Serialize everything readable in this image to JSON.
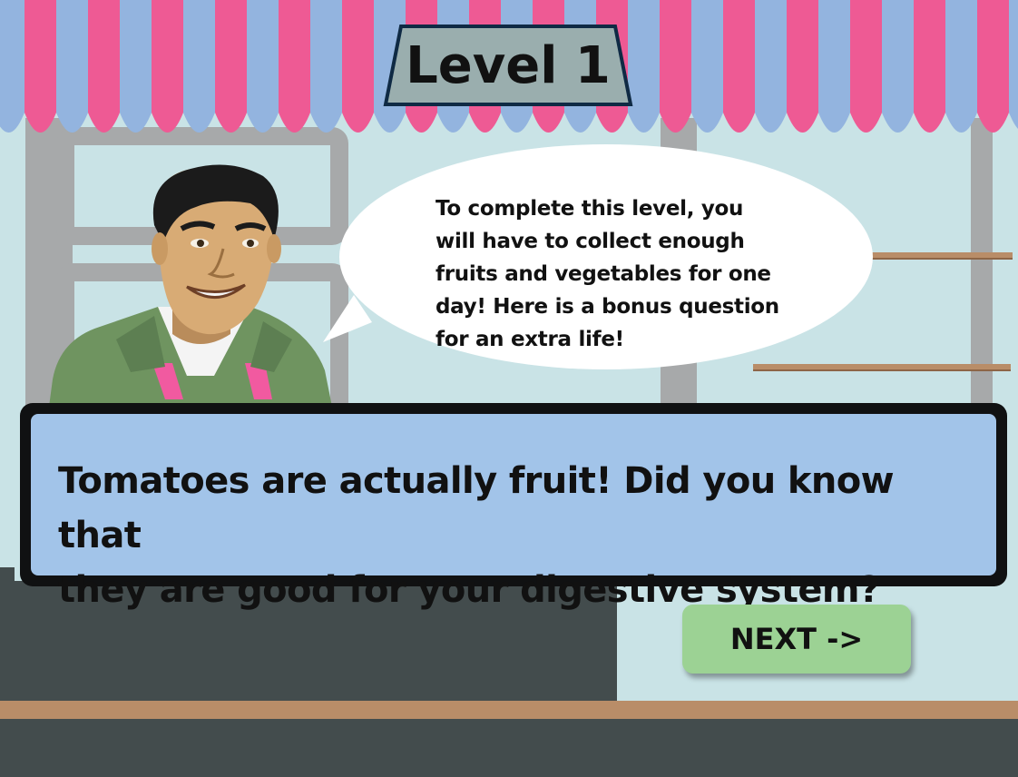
{
  "level": {
    "title": "Level 1"
  },
  "speech_bubble": {
    "lines": [
      "To complete this level, you",
      "will have to collect enough",
      "fruits and vegetables for one",
      "day! Here is a bonus question",
      "for an extra life!"
    ]
  },
  "question": {
    "lines": [
      "Tomatoes are actually fruit! Did you know that",
      "they are good for your digestive system?"
    ]
  },
  "next_button": {
    "label": "NEXT ->"
  },
  "colors": {
    "awning_pink": "#ee5a94",
    "awning_blue": "#93b4df",
    "question_bg": "#a2c4e9",
    "next_button_bg": "#9cd294",
    "sign_bg": "#9aaeae",
    "counter": "#434c4d"
  }
}
